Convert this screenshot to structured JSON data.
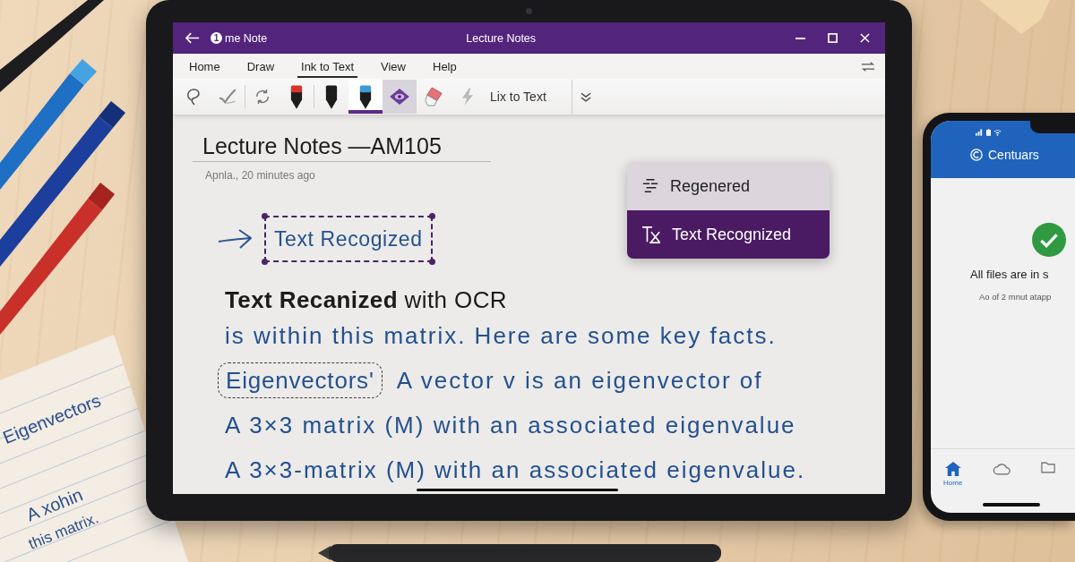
{
  "paper_note": {
    "lines": [
      "Eigenvectors",
      "A xohin",
      "this matrix."
    ]
  },
  "app": {
    "title_bar": {
      "badge": "1",
      "app_name": "me Note",
      "title": "Lecture Notes"
    },
    "menu_tabs": [
      {
        "label": "Home",
        "selected": false
      },
      {
        "label": "Draw",
        "selected": false
      },
      {
        "label": "Ink to Text",
        "selected": true
      },
      {
        "label": "View",
        "selected": false
      },
      {
        "label": "Help",
        "selected": false
      }
    ],
    "toolbar": {
      "tools": [
        {
          "kind": "lasso",
          "selected": false,
          "pressed": false
        },
        {
          "kind": "stroke",
          "selected": false,
          "pressed": false
        },
        {
          "kind": "rotate",
          "selected": false,
          "pressed": false
        },
        {
          "kind": "pen",
          "color": "#d8332b",
          "selected": false,
          "pressed": false
        },
        {
          "kind": "pen",
          "color": "#1b1b1b",
          "selected": false,
          "pressed": false
        },
        {
          "kind": "pen",
          "color": "#3d9ad8",
          "selected": true,
          "pressed": false
        },
        {
          "kind": "diamond",
          "selected": false,
          "pressed": true
        },
        {
          "kind": "eraser",
          "selected": false,
          "pressed": false
        },
        {
          "kind": "lightning",
          "selected": false,
          "pressed": false
        }
      ],
      "convert_button": "Lix to Text"
    },
    "page": {
      "title": "Lecture Notes —AM105",
      "meta": "Apnla., 20 minutes ago",
      "selection": "Text Recogized",
      "heading": "**Text Recanized** with OCR",
      "lines": [
        {
          "text": "is within this matrix. Here are some key facts."
        },
        {
          "lasso_word": "Eigenvectors'",
          "text": "A vector v is an eigenvector of"
        },
        {
          "text": "A 3×3 matrix (M) with an associated eigenvalue"
        },
        {
          "text": "A 3×3-matrix (M) with an associated eigenvalue."
        }
      ]
    },
    "context_menu": {
      "items": [
        {
          "kind": "regenerate",
          "label": "Regenered",
          "selected": false
        },
        {
          "kind": "text",
          "label": "Text Recognized",
          "selected": true
        }
      ]
    }
  },
  "phone": {
    "header": "Centuars",
    "status": "All files are in s",
    "detail": "Ao of 2 mnut atapp",
    "nav": [
      {
        "kind": "home",
        "label": "Home",
        "selected": true
      },
      {
        "kind": "cloud",
        "selected": false
      },
      {
        "kind": "folder",
        "selected": false
      }
    ]
  }
}
